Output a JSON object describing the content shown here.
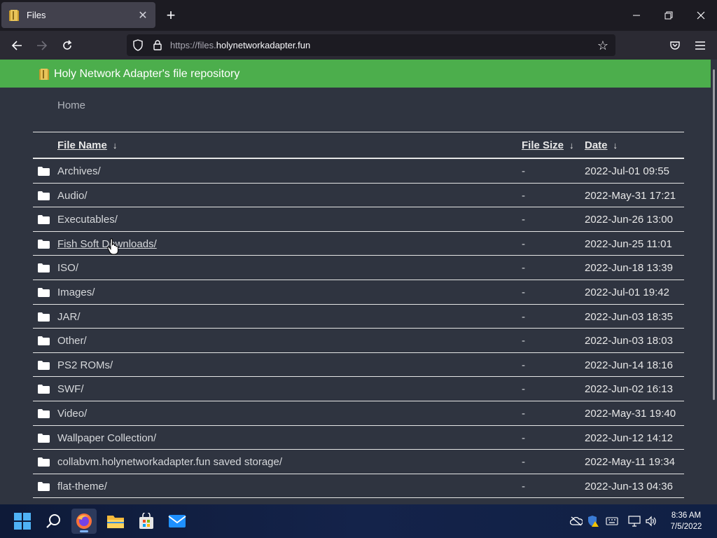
{
  "browser": {
    "tab_title": "Files",
    "new_tab_label": "+",
    "url_prefix": "https://files.",
    "url_domain": "holynetworkadapter.fun"
  },
  "page": {
    "header_title": "Holy Network Adapter's file repository",
    "breadcrumb": "Home",
    "columns": {
      "name": "File Name",
      "size": "File Size",
      "date": "Date",
      "sort_arrow": "↓"
    },
    "rows": [
      {
        "name": "Archives/",
        "size": "-",
        "date": "2022-Jul-01 09:55"
      },
      {
        "name": "Audio/",
        "size": "-",
        "date": "2022-May-31 17:21"
      },
      {
        "name": "Executables/",
        "size": "-",
        "date": "2022-Jun-26 13:00"
      },
      {
        "name": "Fish Soft Downloads/",
        "size": "-",
        "date": "2022-Jun-25 11:01"
      },
      {
        "name": "ISO/",
        "size": "-",
        "date": "2022-Jun-18 13:39"
      },
      {
        "name": "Images/",
        "size": "-",
        "date": "2022-Jul-01 19:42"
      },
      {
        "name": "JAR/",
        "size": "-",
        "date": "2022-Jun-03 18:35"
      },
      {
        "name": "Other/",
        "size": "-",
        "date": "2022-Jun-03 18:03"
      },
      {
        "name": "PS2 ROMs/",
        "size": "-",
        "date": "2022-Jun-14 18:16"
      },
      {
        "name": "SWF/",
        "size": "-",
        "date": "2022-Jun-02 16:13"
      },
      {
        "name": "Video/",
        "size": "-",
        "date": "2022-May-31 19:40"
      },
      {
        "name": "Wallpaper Collection/",
        "size": "-",
        "date": "2022-Jun-12 14:12"
      },
      {
        "name": "collabvm.holynetworkadapter.fun saved storage/",
        "size": "-",
        "date": "2022-May-11 19:34"
      },
      {
        "name": "flat-theme/",
        "size": "-",
        "date": "2022-Jun-13 04:36"
      }
    ]
  },
  "taskbar": {
    "time": "8:36 AM",
    "date": "7/5/2022"
  },
  "colors": {
    "header_green": "#4cae4c",
    "page_bg": "#2f3440",
    "chrome_dark": "#1c1b22",
    "toolbar": "#2b2a33"
  },
  "icons": [
    "folder-icon",
    "close-icon",
    "plus-icon",
    "back-icon",
    "forward-icon",
    "reload-icon",
    "shield-icon",
    "lock-icon",
    "star-icon",
    "pocket-icon",
    "menu-icon",
    "windows-start-icon",
    "search-icon",
    "firefox-icon",
    "file-explorer-icon",
    "store-icon",
    "mail-icon"
  ]
}
